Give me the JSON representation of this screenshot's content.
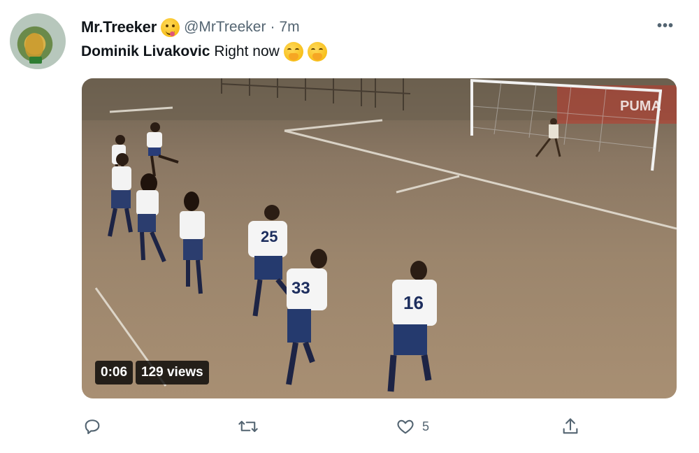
{
  "author": {
    "name": "Mr.Treeker",
    "handle": "@MrTreeker",
    "separator": "·",
    "time": "7m"
  },
  "tweet": {
    "bold_text": "Dominik Livakovic",
    "text": "Right now"
  },
  "media": {
    "duration": "0:06",
    "views": "129 views",
    "jersey_numbers": [
      "25",
      "33",
      "16"
    ],
    "banner_text": "PUMA"
  },
  "actions": {
    "reply_icon": "reply-icon",
    "retweet_icon": "retweet-icon",
    "like_icon": "like-icon",
    "like_count": "5",
    "share_icon": "share-icon"
  },
  "colors": {
    "text_primary": "#0f1419",
    "text_secondary": "#536471"
  }
}
